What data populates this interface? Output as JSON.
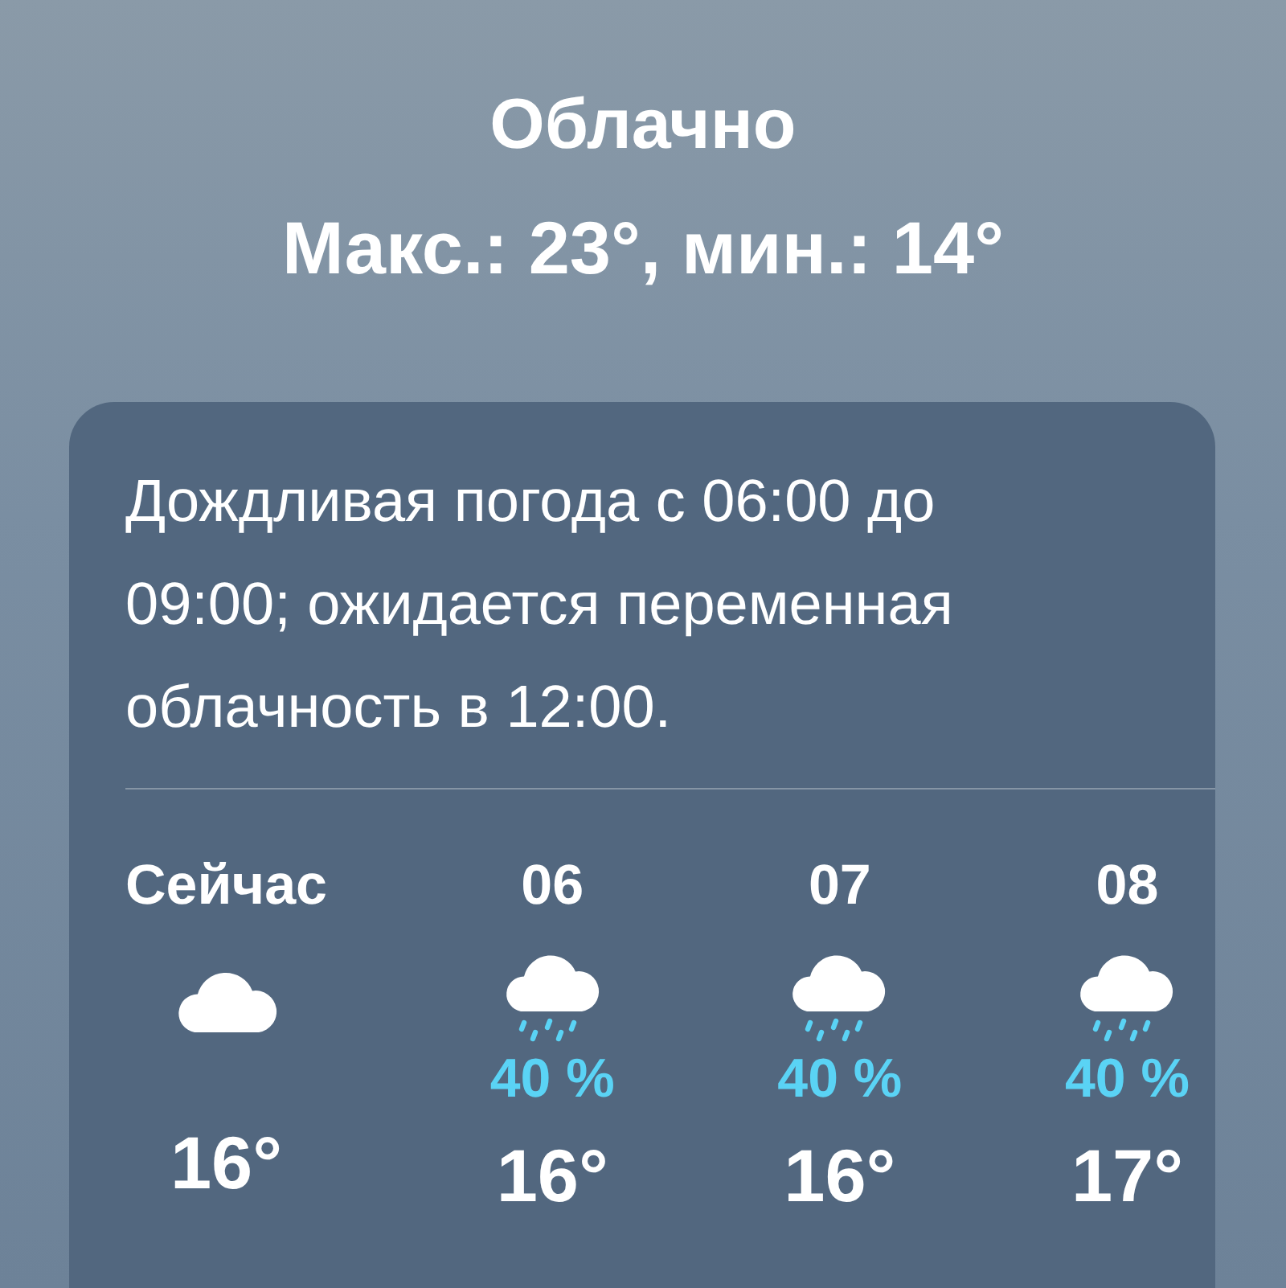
{
  "condition": "Облачно",
  "high_low": "Макс.: 23°, мин.: 14°",
  "forecast_card": {
    "summary": "Дождливая погода с 06:00 до 09:00; ожидается переменная облачность в 12:00.",
    "hours": [
      {
        "label": "Сейчас",
        "kind": "cloud",
        "temp": "16°"
      },
      {
        "label": "06",
        "kind": "rain",
        "precip": "40 %",
        "temp": "16°"
      },
      {
        "label": "07",
        "kind": "rain",
        "precip": "40 %",
        "temp": "16°"
      },
      {
        "label": "08",
        "kind": "rain",
        "precip": "40 %",
        "temp": "17°"
      }
    ]
  }
}
